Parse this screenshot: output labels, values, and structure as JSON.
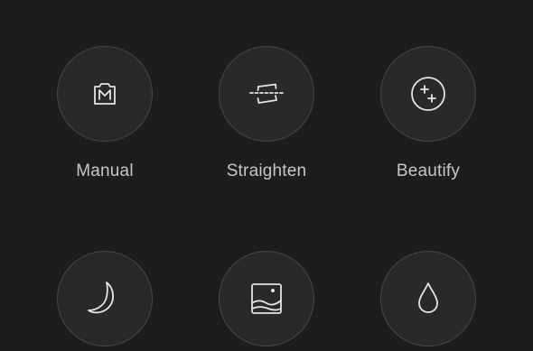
{
  "modes": [
    {
      "label": "Manual",
      "icon": "manual-camera-icon"
    },
    {
      "label": "Straighten",
      "icon": "straighten-icon"
    },
    {
      "label": "Beautify",
      "icon": "beautify-sparkle-icon"
    },
    {
      "label": "",
      "icon": "night-moon-icon"
    },
    {
      "label": "",
      "icon": "landscape-image-icon"
    },
    {
      "label": "",
      "icon": "water-drop-icon"
    }
  ],
  "colors": {
    "background": "#1f1c1c",
    "button_fill": "#2b2828",
    "button_border": "#4a4646",
    "icon": "#e6e3e3",
    "label": "#c9c6c6"
  }
}
